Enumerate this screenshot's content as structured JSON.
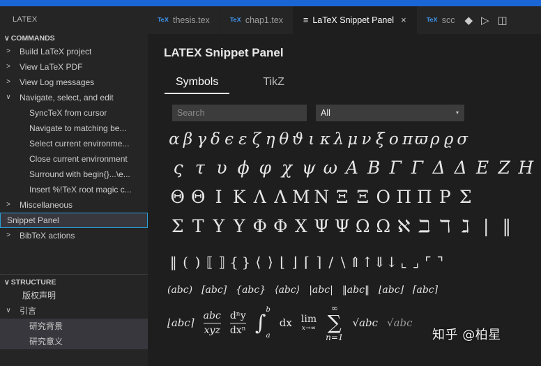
{
  "sidebar": {
    "title": "LATEX",
    "commands_header": "COMMANDS",
    "commands": [
      {
        "label": "Build LaTeX project",
        "chevron": ">"
      },
      {
        "label": "View LaTeX PDF",
        "chevron": ">"
      },
      {
        "label": "View Log messages",
        "chevron": ">"
      },
      {
        "label": "Navigate, select, and edit",
        "chevron": "∨"
      }
    ],
    "navigate_children": [
      "SyncTeX from cursor",
      "Navigate to matching be...",
      "Select current environme...",
      "Close current environment",
      "Surround with begin{}...\\e...",
      "Insert %!TeX root magic c..."
    ],
    "commands_after": [
      {
        "label": "Miscellaneous",
        "chevron": ">"
      },
      {
        "label": "Snippet Panel",
        "chevron": ""
      },
      {
        "label": "BibTeX actions",
        "chevron": ">"
      }
    ],
    "structure_header": "STRUCTURE",
    "structure": [
      {
        "label": "版权声明",
        "chevron": ""
      },
      {
        "label": "引言",
        "chevron": "∨"
      }
    ],
    "structure_children": [
      "研究背景",
      "研究意义"
    ]
  },
  "tabs": [
    {
      "label": "thesis.tex",
      "icon": "TeX",
      "active": false
    },
    {
      "label": "chap1.tex",
      "icon": "TeX",
      "active": false
    },
    {
      "label": "LaTeX Snippet Panel",
      "icon": "≡",
      "active": true,
      "close": "×"
    },
    {
      "label": "scc",
      "icon": "TeX",
      "active": false
    }
  ],
  "tab_actions": {
    "git": "◆",
    "run": "▷",
    "split": "◫"
  },
  "panel": {
    "title": "LATEX Snippet Panel",
    "subtabs": [
      "Symbols",
      "TikZ"
    ],
    "search_placeholder": "Search",
    "filter_value": "All",
    "filter_arrow": "▾"
  },
  "symbols": {
    "row1": [
      "α",
      "β",
      "γ",
      "δ",
      "ϵ",
      "ε",
      "ζ",
      "η",
      "θ",
      "ϑ",
      "ι",
      "κ",
      "λ",
      "μ",
      "ν",
      "ξ",
      "ο",
      "π",
      "ϖ",
      "ρ",
      "ϱ",
      "σ"
    ],
    "row2": [
      "ς",
      "τ",
      "υ",
      "ϕ",
      "φ",
      "χ",
      "ψ",
      "ω",
      "A",
      "B",
      "Γ",
      "Γ",
      "Δ",
      "Δ",
      "E",
      "Z",
      "H"
    ],
    "row3": [
      "Θ",
      "Θ",
      "I",
      "K",
      "Λ",
      "Λ",
      "M",
      "N",
      "Ξ",
      "Ξ",
      "O",
      "Π",
      "Π",
      "P",
      "Σ"
    ],
    "row4": [
      "Σ",
      "T",
      "Υ",
      "Υ",
      "Φ",
      "Φ",
      "X",
      "Ψ",
      "Ψ",
      "Ω",
      "Ω",
      "ℵ",
      "ℶ",
      "ℸ",
      "ℷ",
      "|",
      "‖"
    ],
    "row5": [
      "‖",
      "(",
      ")",
      "⟦",
      "⟧",
      "{",
      "}",
      "⟨",
      "⟩",
      "⌊",
      "⌋",
      "⌈",
      "⌉",
      "/",
      "\\",
      "⇑",
      "↑",
      "⇓",
      "↓",
      "⌞",
      "⌟",
      "⌜",
      "⌝"
    ],
    "row6": [
      "(abc)",
      "[abc]",
      "{abc}",
      "⟨abc⟩",
      "|abc|",
      "‖abc‖",
      "⌊abc⌋",
      "⌈abc⌉"
    ],
    "row7": {
      "ceil": "⌊abc⌉",
      "frac1_num": "abc",
      "frac1_den": "xyz",
      "frac2_num": "dⁿy",
      "frac2_den": "dxⁿ",
      "int": "∫",
      "int_upper": "b",
      "int_lower": "a",
      "dx": "dx",
      "lim": "lim",
      "lim_sub": "x→∞",
      "sum": "∑",
      "sum_upper": "∞",
      "sum_lower": "n=1",
      "sqrt": "√abc",
      "sqrt2": "√abc"
    }
  },
  "watermark": "知乎 @柏星"
}
